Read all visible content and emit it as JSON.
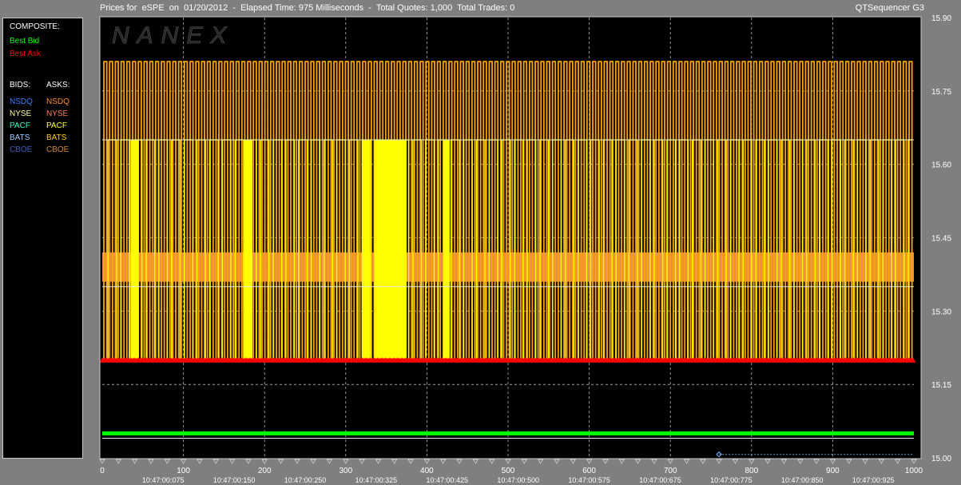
{
  "header": {
    "title": "Prices for  eSPE  on  01/20/2012  -  Elapsed Time: 975 Milliseconds  -  Total Quotes: 1,000  Total Trades: 0",
    "app_name": "QTSequencer G3"
  },
  "watermark": "NANEX",
  "legend": {
    "composite_title": "COMPOSITE:",
    "best_bid": "Best Bid",
    "best_ask": "Best Ask",
    "bids_title": "BIDS:",
    "asks_title": "ASKS:",
    "bids": [
      "NSDQ",
      "NYSE",
      "PACF",
      "BATS",
      "CBOE"
    ],
    "asks": [
      "NSDQ",
      "NYSE",
      "PACF",
      "BATS",
      "CBOE"
    ],
    "colors": {
      "best_bid": "#00ff00",
      "best_ask": "#ff0000",
      "bid_nsdq": "#3a7cff",
      "bid_nyse": "#ffff99",
      "bid_pacf": "#33ffcc",
      "bid_bats": "#99ccff",
      "bid_cboe": "#3b5bb5",
      "ask_nsdq": "#ff8c2a",
      "ask_nyse": "#ff7f50",
      "ask_pacf": "#ffff33",
      "ask_bats": "#ffcc00",
      "ask_cboe": "#d08a3a"
    }
  },
  "chart_data": {
    "type": "line",
    "x_range": [
      0,
      1000
    ],
    "y_range": [
      15.0,
      15.9
    ],
    "y_ticks": [
      "15.00",
      "15.15",
      "15.30",
      "15.45",
      "15.60",
      "15.75",
      "15.90"
    ],
    "x_ticks": [
      "0",
      "100",
      "200",
      "300",
      "400",
      "500",
      "600",
      "700",
      "800",
      "900",
      "1000"
    ],
    "time_labels": [
      "10:47:00:075",
      "10:47:00:150",
      "10:47:00:250",
      "10:47:00:325",
      "10:47:00:425",
      "10:47:00:500",
      "10:47:00:575",
      "10:47:00:675",
      "10:47:00:775",
      "10:47:00:850",
      "10:47:00:925"
    ],
    "grid": true,
    "series": [
      {
        "name": "Best Bid",
        "level": 15.05,
        "color": "#00ff00"
      },
      {
        "name": "Best Ask",
        "level": 15.2,
        "color": "#ff0000"
      },
      {
        "name": "ASKS",
        "low": 15.2,
        "high": 15.81,
        "color": "#ffa500"
      },
      {
        "name": "ASKS",
        "low": 15.2,
        "high": 15.65,
        "color": "#ffff00"
      }
    ],
    "reference_lines": [
      15.65,
      15.35,
      15.04
    ]
  }
}
